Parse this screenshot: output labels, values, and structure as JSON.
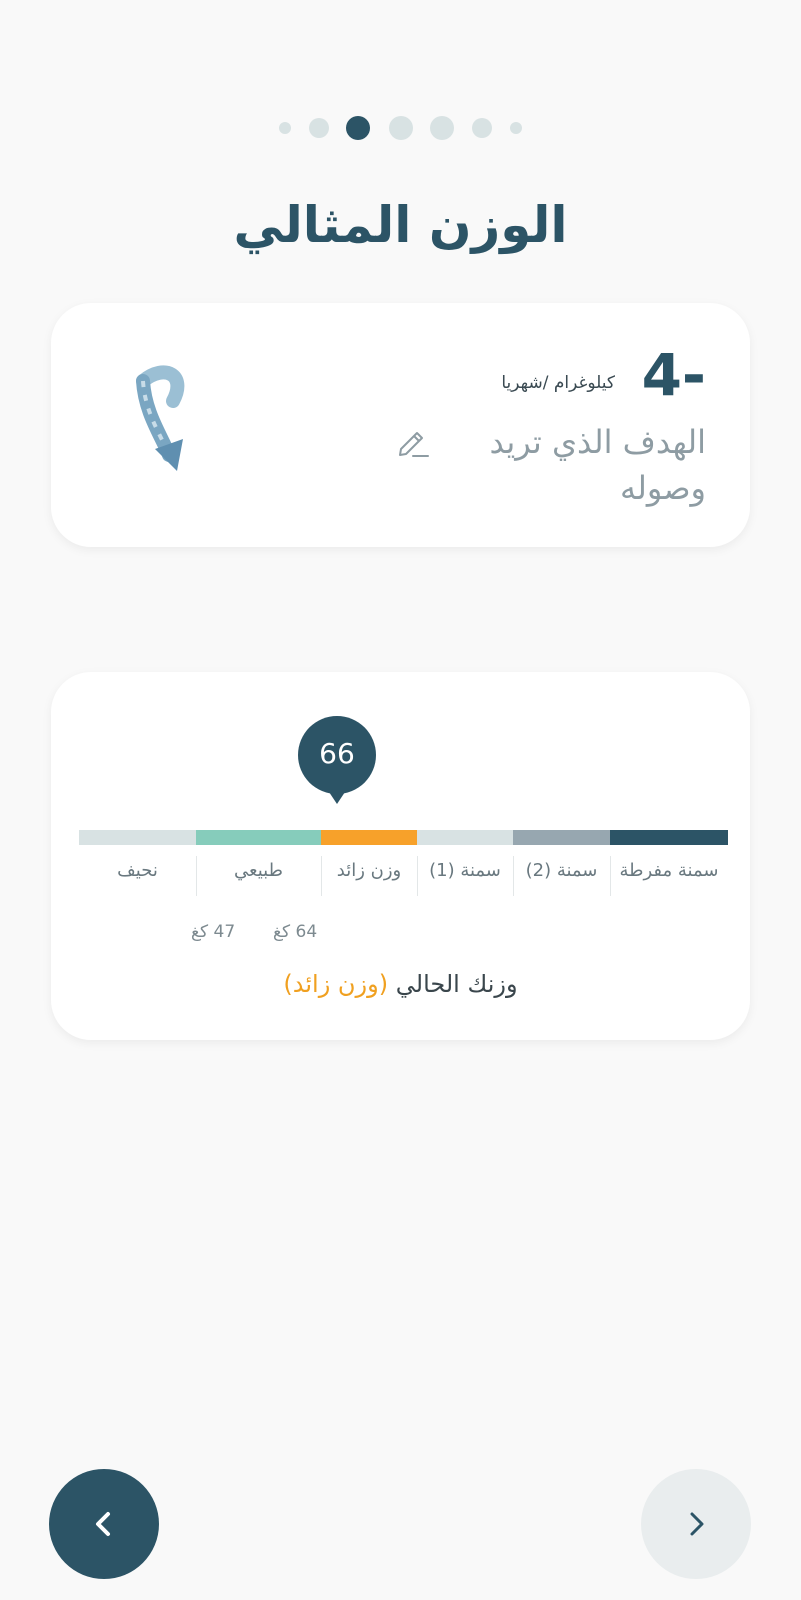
{
  "pagination": {
    "total": 7,
    "active_index": 2
  },
  "page_title": "الوزن المثالي",
  "goal_card": {
    "value": "4-",
    "unit": "كيلوغرام /شهريا",
    "label": "الهدف الذي تريد وصوله",
    "edit_icon": "pencil-icon",
    "illustration": "down-curved-arrow-illustration"
  },
  "bmi_card": {
    "current_weight": "66",
    "segments": [
      {
        "label": "نحيف",
        "color": "#d8e2e3"
      },
      {
        "label": "طبيعي",
        "color": "#86ccbb"
      },
      {
        "label": "وزن زائد",
        "color": "#f7a12a"
      },
      {
        "label": "سمنة (1)",
        "color": "#d8e2e3"
      },
      {
        "label": "سمنة (2)",
        "color": "#97a7b0"
      },
      {
        "label": "سمنة مفرطة",
        "color": "#2c5466"
      }
    ],
    "range_low": "47 كغ",
    "range_high": "64 كغ",
    "current_prefix": "وزنك الحالي",
    "current_status": "(وزن زائد)",
    "status_color": "#f0a020"
  },
  "navigation": {
    "prev_icon": "chevron-left-icon",
    "next_icon": "chevron-right-icon"
  }
}
